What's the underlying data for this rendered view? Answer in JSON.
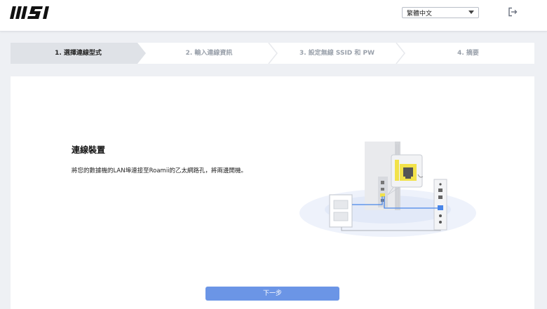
{
  "header": {
    "logo_text": "MSI",
    "language": {
      "selected": "繁體中文"
    },
    "logout_icon": "logout-icon"
  },
  "steps": [
    {
      "label": "1. 選擇連線型式",
      "active": true
    },
    {
      "label": "2. 輸入連線資訊",
      "active": false
    },
    {
      "label": "3. 設定無線 SSID 和 PW",
      "active": false
    },
    {
      "label": "4. 摘要",
      "active": false
    }
  ],
  "content": {
    "title": "連線裝置",
    "description": "將您的數據機的LAN埠連接至Roamii的乙太網路孔，將兩邊開機。",
    "next_label": "下一步"
  },
  "colors": {
    "accent": "#6b95e6",
    "highlight": "#f2e24a",
    "cable": "#4a86e8",
    "active_step": "#dfe2e7",
    "background": "#eef0f4"
  }
}
